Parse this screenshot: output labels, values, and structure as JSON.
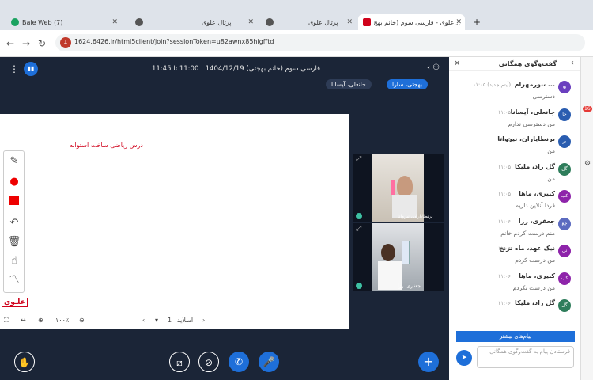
{
  "browser": {
    "tabs": [
      {
        "label": "Bale Web (7)",
        "color": "#1aa260"
      },
      {
        "label": "پرتال علوی",
        "color": "#555555"
      },
      {
        "label": "پرتال علوی",
        "color": "#555555"
      },
      {
        "label": "علوی - فارسی سوم (خانم بهج...",
        "color": "#d0021b"
      }
    ],
    "new_tab": "+",
    "url": "1624.6426.ir/html5client/join?sessionToken=u82awnx85higfftd"
  },
  "meeting": {
    "title": "فارسی سوم (خانم بهجتی) 1404/12/19 | 11:00 تا 11:45",
    "presenters": [
      "بهجتی، سارا",
      "جانعلی، آیسانا"
    ],
    "whiteboard_text": "درس ریاضی ساخت استوانه",
    "logo_text": "علـوی",
    "slide_label": "اسلاید",
    "slide_number": "1",
    "zoom": "۱۰۰٪",
    "videos": [
      {
        "name": "برنطایاران، نیروانا"
      },
      {
        "name": "جعفری، رزا"
      }
    ]
  },
  "chat": {
    "title": "گفت‌وگوی همگانی",
    "messages": [
      {
        "avatar": "بو",
        "color": "#6a3fbf",
        "name": "بورمهرام، ...",
        "time": "۱۱:۰۵ (آیتم جدید)",
        "text": "دسترسی"
      },
      {
        "avatar": "جا",
        "color": "#2a5db0",
        "name": "جانعلی، آیسانا",
        "time": "۱۱:۰۵",
        "text": "من دسترسی ندارم"
      },
      {
        "avatar": "بر",
        "color": "#2a5db0",
        "name": "برنطایاران، نیروانا",
        "time": "۱۱:۰۵",
        "text": "من"
      },
      {
        "avatar": "گل",
        "color": "#2e7d5b",
        "name": "گل راد، ملیکا",
        "time": "۱۱:۰۵",
        "text": "من"
      },
      {
        "avatar": "کب",
        "color": "#8e24aa",
        "name": "کبیری، ماها",
        "time": "۱۱:۰۵",
        "text": "فردا آنلاین داریم"
      },
      {
        "avatar": "جع",
        "color": "#5c6bc0",
        "name": "جعفری، رزا",
        "time": "۱۱:۰۶",
        "text": "منم درست کردم خانم"
      },
      {
        "avatar": "نی",
        "color": "#8e24aa",
        "name": "نیک عهد، ماه ترنج",
        "time": "۱۱:۰۶",
        "text": "من درست کردم"
      },
      {
        "avatar": "کب",
        "color": "#8e24aa",
        "name": "کبیری، ماها",
        "time": "۱۱:۰۶",
        "text": "من درست نکردم"
      },
      {
        "avatar": "گل",
        "color": "#2e7d5b",
        "name": "گل راد، ملیکا",
        "time": "۱۱:۰۶",
        "text": ""
      }
    ],
    "more_button": "پیام‌های بیشتر",
    "input_placeholder": "فرستادن پیام به گفت‌وگوی همگانی"
  },
  "strip": {
    "badge": "16"
  }
}
